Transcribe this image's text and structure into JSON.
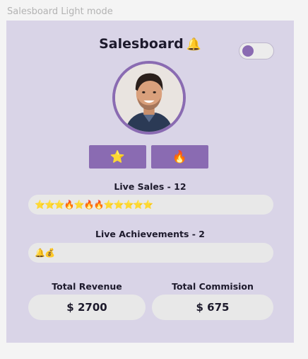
{
  "frame_label": "Salesboard Light mode",
  "header": {
    "title": "Salesboard",
    "title_icon": "🔔"
  },
  "toggle": {
    "state": "off"
  },
  "tabs": [
    {
      "icon": "⭐"
    },
    {
      "icon": "🔥"
    }
  ],
  "live_sales": {
    "label": "Live Sales - 12",
    "items": "⭐⭐⭐🔥⭐🔥🔥⭐⭐⭐⭐⭐"
  },
  "live_achievements": {
    "label": "Live Achievements - 2",
    "items": "🔔💰"
  },
  "stats": {
    "revenue_label": "Total Revenue",
    "revenue_value": "$ 2700",
    "commission_label": "Total Commision",
    "commission_value": "$ 675"
  },
  "colors": {
    "frame_bg": "#d9d4e7",
    "accent": "#8a6bb2",
    "pill_bg": "#e8e8e8",
    "text": "#1d1a2c"
  }
}
